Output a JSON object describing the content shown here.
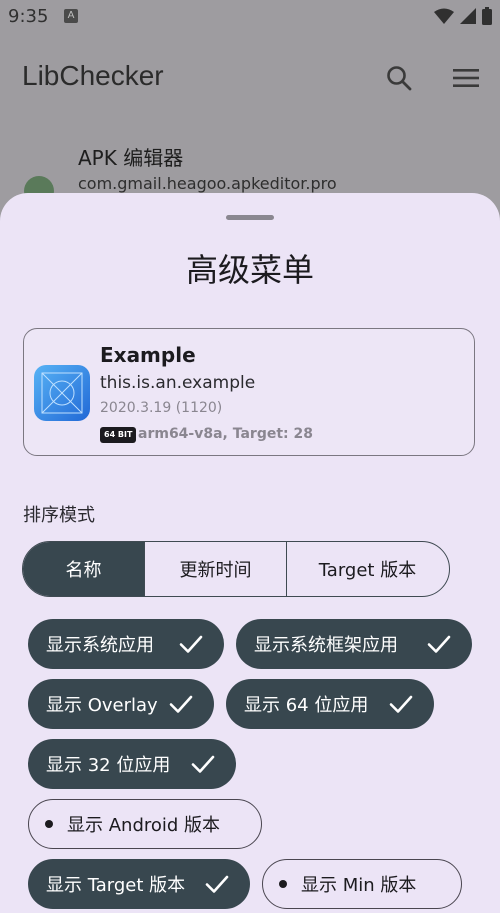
{
  "status_bar": {
    "time": "9:35",
    "notification_icon": "A"
  },
  "app_bar": {
    "title": "LibChecker",
    "search_icon": "search-icon",
    "menu_icon": "menu-icon"
  },
  "background_item": {
    "title": "APK 编辑器",
    "package": "com.gmail.heagoo.apkeditor.pro"
  },
  "sheet": {
    "title": "高级菜单",
    "example_card": {
      "name": "Example",
      "package": "this.is.an.example",
      "version": "2020.3.19 (1120)",
      "abi_badge": "64 BIT",
      "abi_info": "arm64-v8a, Target: 28"
    },
    "sort_label": "排序模式",
    "sort_modes": [
      {
        "label": "名称",
        "selected": true
      },
      {
        "label": "更新时间",
        "selected": false
      },
      {
        "label": "Target 版本",
        "selected": false
      }
    ],
    "filters": [
      {
        "label": "显示系统应用",
        "checked": true
      },
      {
        "label": "显示系统框架应用",
        "checked": true
      },
      {
        "label": "显示 Overlay",
        "checked": true
      },
      {
        "label": "显示 64 位应用",
        "checked": true
      },
      {
        "label": "显示 32 位应用",
        "checked": true
      },
      {
        "label": "显示 Android 版本",
        "checked": false
      },
      {
        "label": "显示 Target 版本",
        "checked": true
      },
      {
        "label": "显示 Min 版本",
        "checked": false
      }
    ]
  },
  "colors": {
    "sheet_bg": "#ece4f6",
    "chip_active": "#38474f",
    "scrim": "#9e9ca0"
  }
}
